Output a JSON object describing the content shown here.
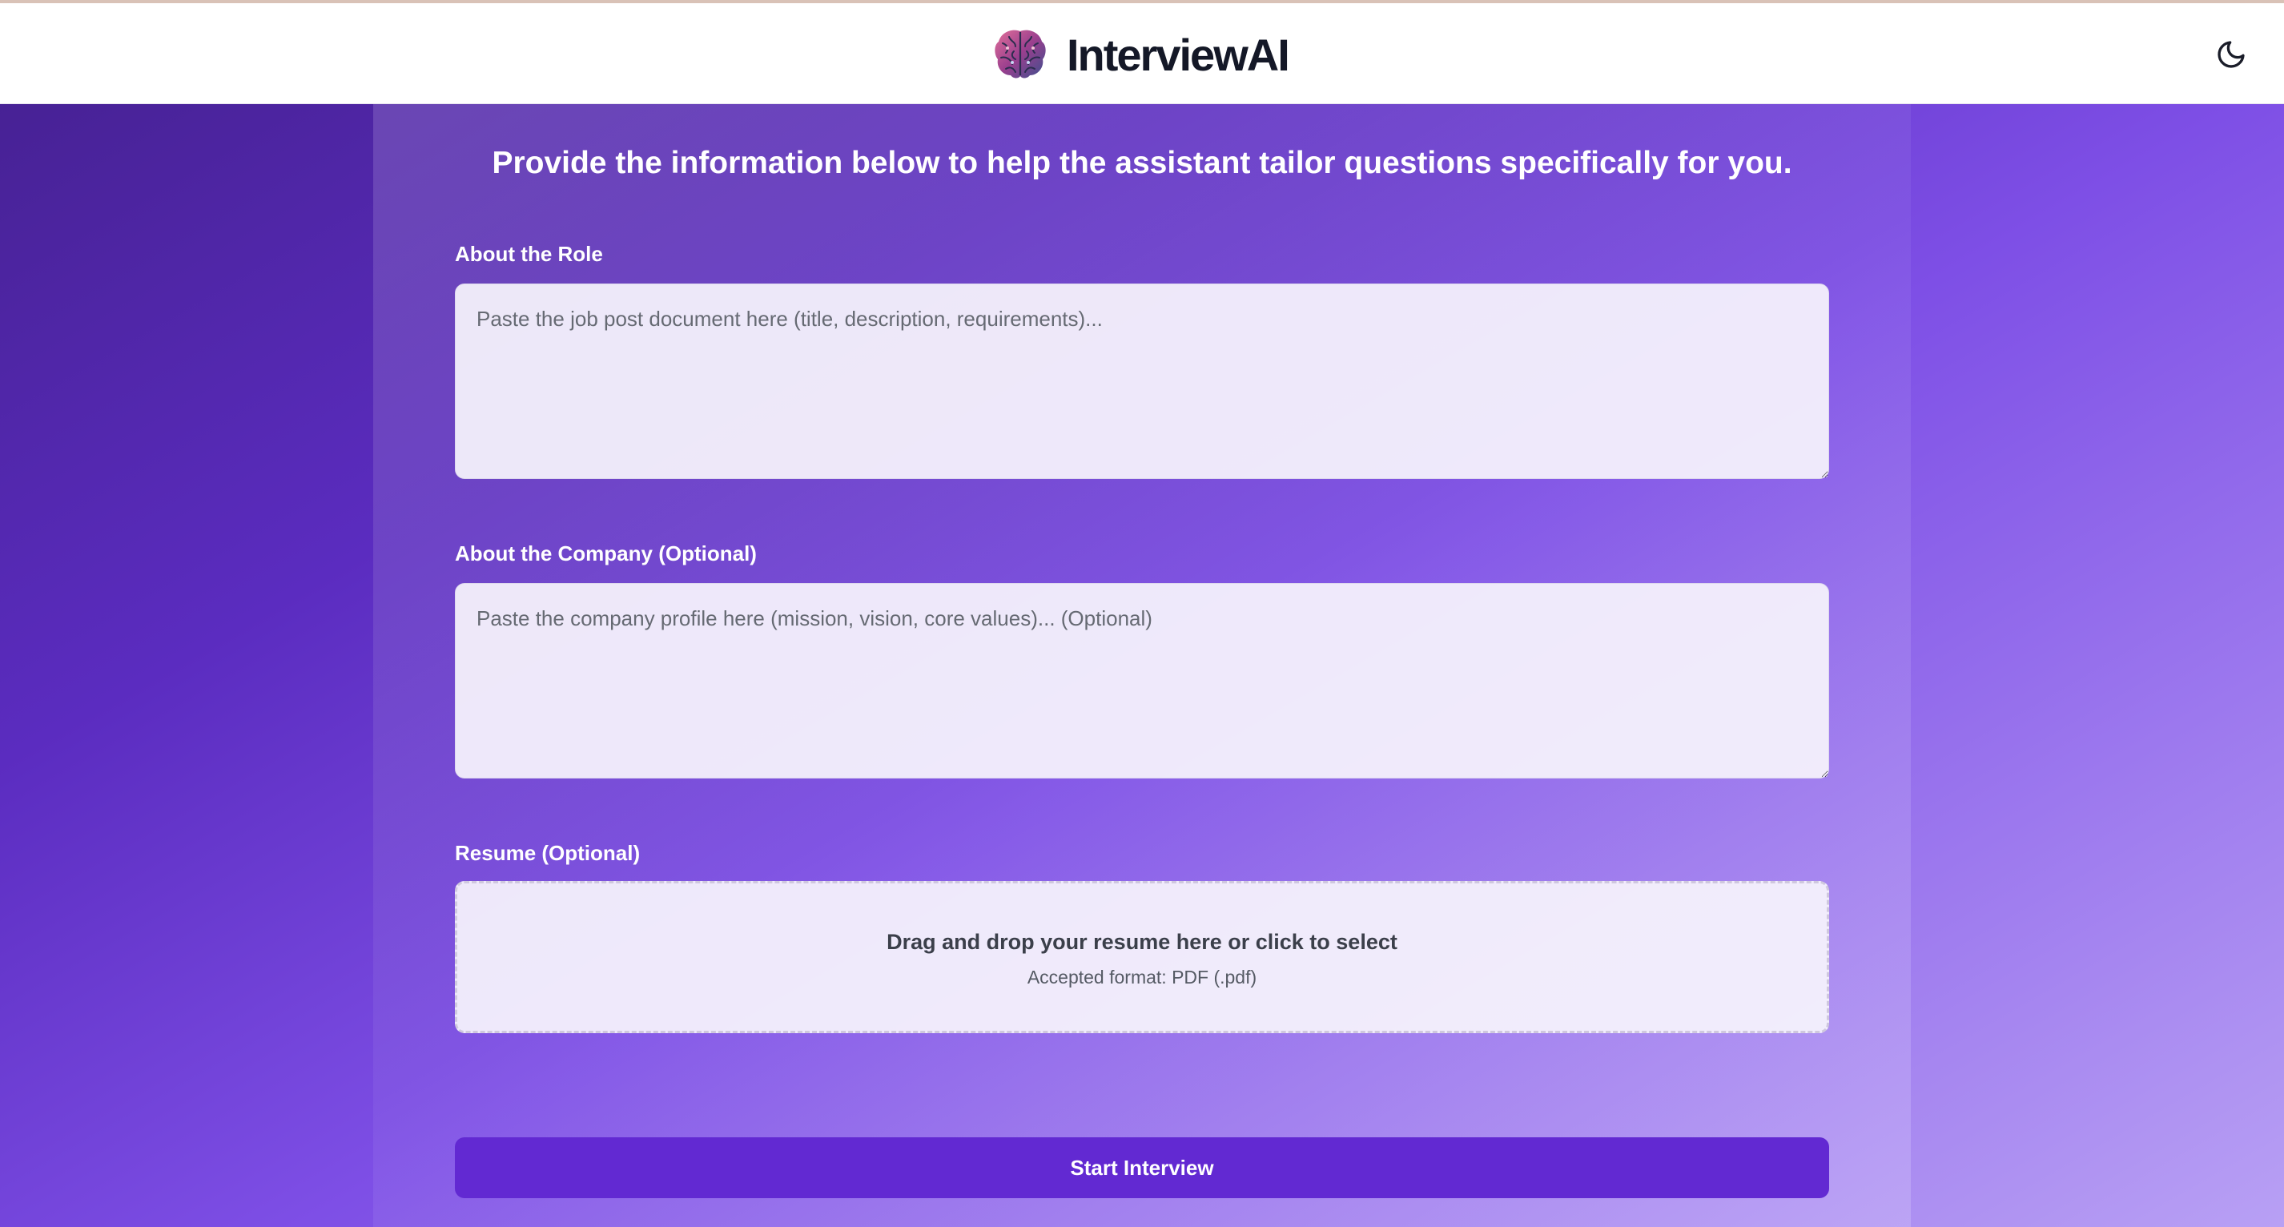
{
  "app": {
    "name": "InterviewAI",
    "logo_icon": "brain-icon",
    "theme_toggle_icon": "moon-icon"
  },
  "form": {
    "intro": "Provide the information below to help the assistant tailor questions specifically for you.",
    "role": {
      "label": "About the Role",
      "placeholder": "Paste the job post document here (title, description, requirements)...",
      "value": ""
    },
    "company": {
      "label": "About the Company  (Optional)",
      "placeholder": "Paste the company profile here (mission, vision, core values)... (Optional)",
      "value": ""
    },
    "resume": {
      "label": "Resume (Optional)",
      "drop_title": "Drag and drop your resume here or click to select",
      "drop_subtitle": "Accepted format: PDF (.pdf)"
    },
    "submit_label": "Start Interview"
  },
  "colors": {
    "primary_button": "#6229d2",
    "brand_text": "#141827",
    "header_bg": "#ffffff"
  }
}
